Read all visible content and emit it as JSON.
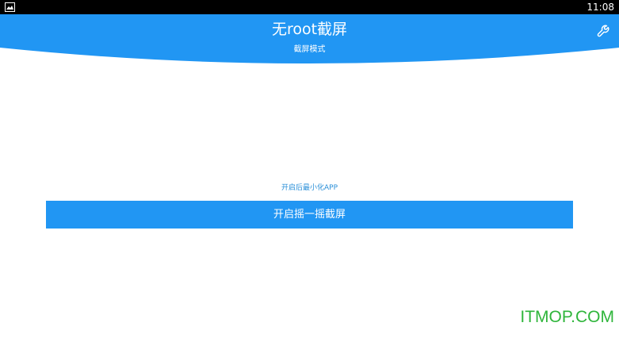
{
  "status_bar": {
    "time": "11:08",
    "left_icon": "screenshot-icon"
  },
  "header": {
    "title": "无root截屏",
    "subtitle": "截屏模式",
    "settings_icon": "wrench-icon",
    "color": "#2196f3"
  },
  "main": {
    "minimize_link": "开启后最小化APP",
    "shake_button": "开启摇一摇截屏"
  },
  "watermark": "ITMOP.COM",
  "colors": {
    "accent": "#2196f3",
    "status_bar": "#000000",
    "watermark": "#2fb53b"
  }
}
